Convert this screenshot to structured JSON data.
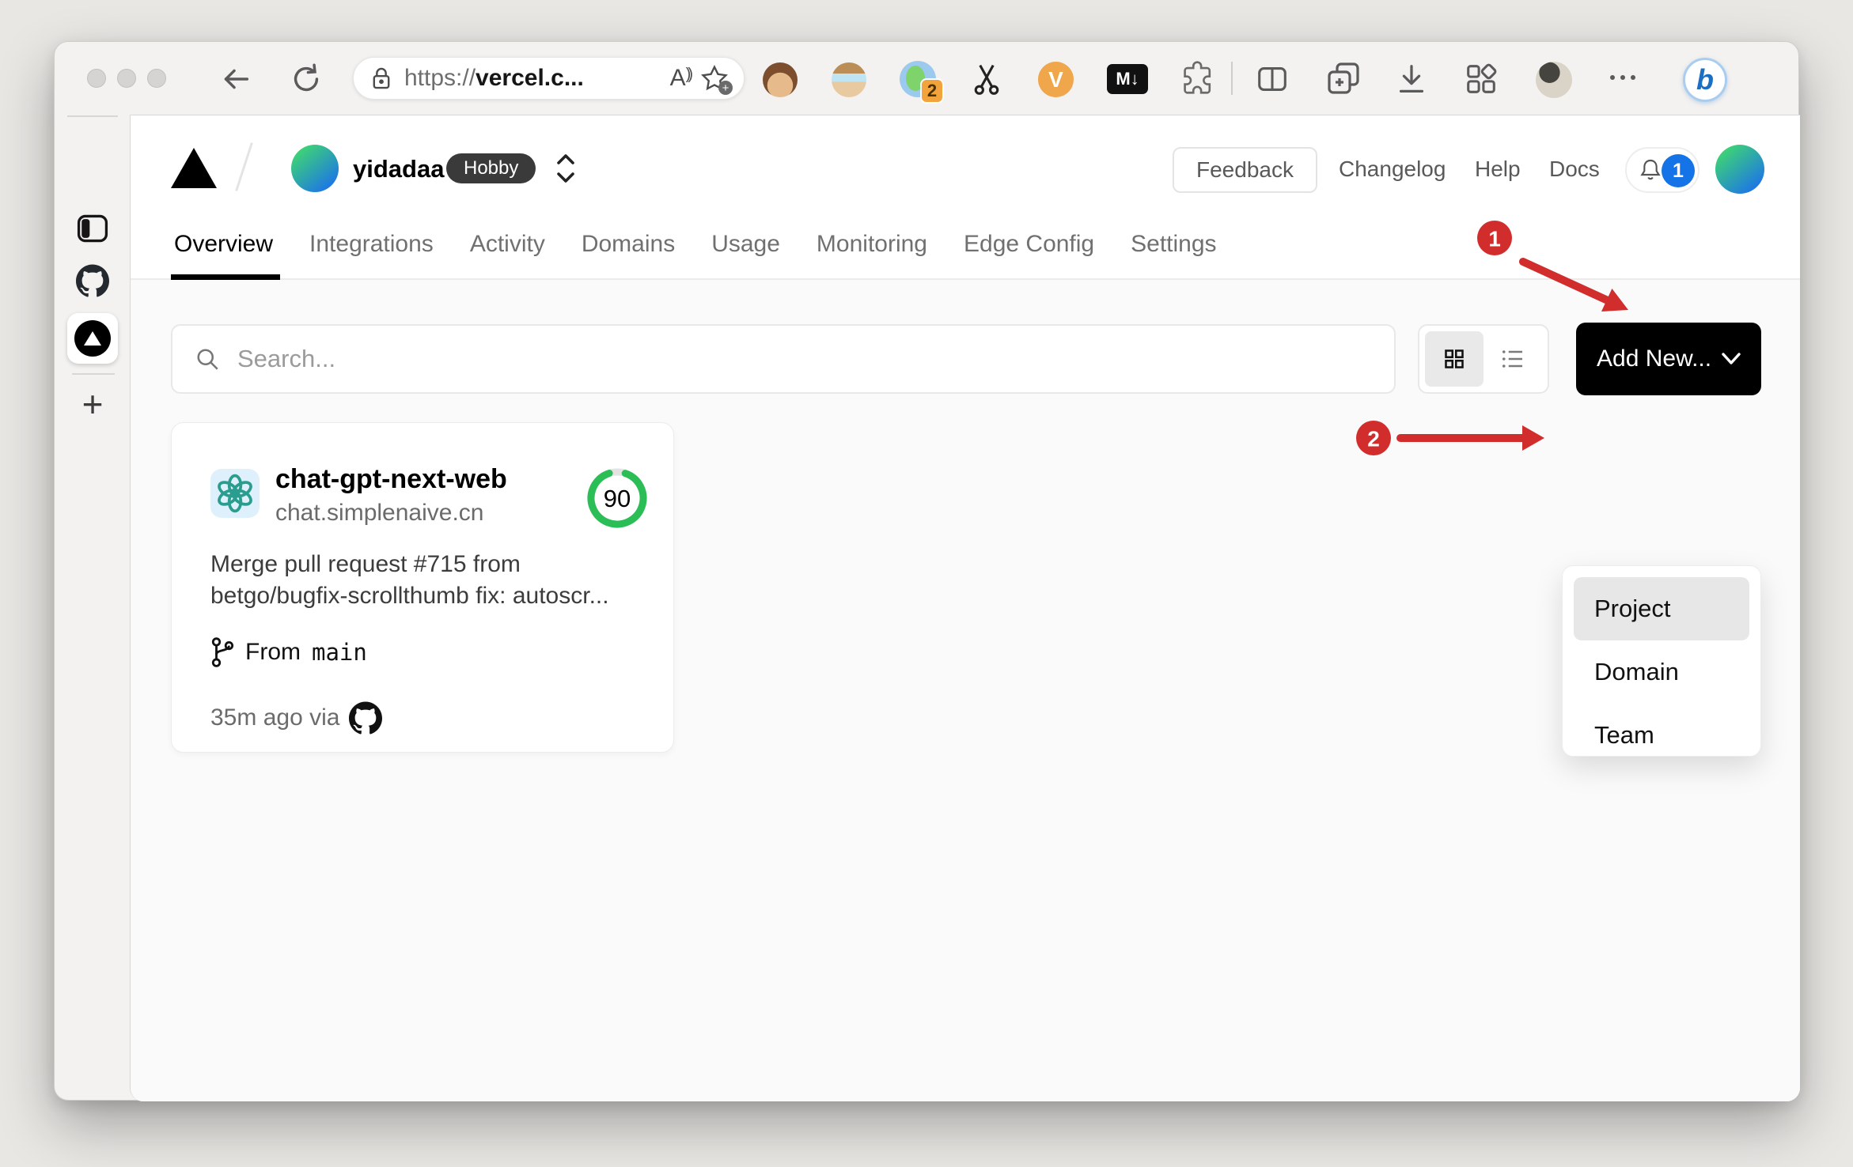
{
  "browser": {
    "url": {
      "scheme": "https://",
      "host_visible": "vercel.c..."
    },
    "reader_mode_label": "A",
    "extensions": {
      "session_badge_count": "2",
      "v_extension_label": "V",
      "markdown_extension_label": "M↓"
    },
    "bing_chat_label": "b"
  },
  "edge_sidebar": {
    "new_tab_label": "+"
  },
  "vercel": {
    "team": {
      "name": "yidadaa",
      "plan_badge": "Hobby"
    },
    "header": {
      "feedback_label": "Feedback",
      "links": [
        {
          "label": "Changelog"
        },
        {
          "label": "Help"
        },
        {
          "label": "Docs"
        }
      ],
      "notification_count": "1"
    },
    "tabs": [
      {
        "label": "Overview"
      },
      {
        "label": "Integrations"
      },
      {
        "label": "Activity"
      },
      {
        "label": "Domains"
      },
      {
        "label": "Usage"
      },
      {
        "label": "Monitoring"
      },
      {
        "label": "Edge Config"
      },
      {
        "label": "Settings"
      }
    ],
    "active_tab": "Overview",
    "toolbar": {
      "search_placeholder": "Search...",
      "add_new_label": "Add New..."
    },
    "add_new_menu": {
      "items": [
        {
          "label": "Project"
        },
        {
          "label": "Domain"
        },
        {
          "label": "Team"
        }
      ],
      "highlighted": "Project"
    },
    "project_card": {
      "name": "chat-gpt-next-web",
      "domain": "chat.simplenaive.cn",
      "score": "90",
      "commit_line1": "Merge pull request #715 from",
      "commit_line2": "betgo/bugfix-scrollthumb fix: autoscr...",
      "branch_prefix": "From",
      "branch_name": "main",
      "deployed_meta": "35m ago via"
    },
    "annotations": [
      {
        "label": "1"
      },
      {
        "label": "2"
      }
    ]
  },
  "colors": {
    "accent_red": "#d22d2d",
    "score_green": "#2cbe56",
    "notification_blue": "#1473e6",
    "add_new_black": "#000000"
  }
}
